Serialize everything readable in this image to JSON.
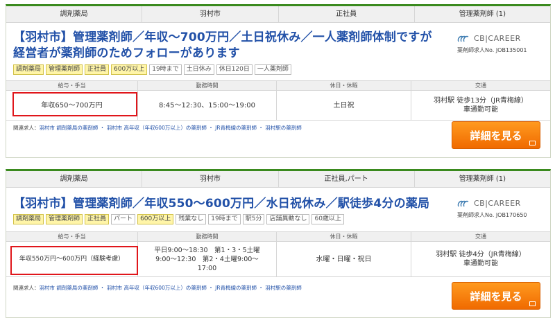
{
  "listings": [
    {
      "header": [
        "調剤薬局",
        "羽村市",
        "正社員",
        "管理薬剤師 (1)"
      ],
      "title": "【羽村市】管理薬剤師／年収～700万円／土日祝休み／一人薬剤師体制ですが経営者が薬剤師のためフォローがあります",
      "logo_text": "CB|CAREER",
      "job_no": "薬剤師求人No. JOB135001",
      "tags": [
        {
          "label": "調剤薬局",
          "hl": true
        },
        {
          "label": "管理薬剤師",
          "hl": true
        },
        {
          "label": "正社員",
          "hl": true
        },
        {
          "label": "600万以上",
          "hl": true
        },
        {
          "label": "19時まで",
          "hl": false
        },
        {
          "label": "土日休み",
          "hl": false
        },
        {
          "label": "休日120日",
          "hl": false
        },
        {
          "label": "一人薬剤師",
          "hl": false
        }
      ],
      "grid_headers": [
        "給与・手当",
        "勤務時間",
        "休日・休暇",
        "交通"
      ],
      "salary": "年収650～700万円",
      "hours": "8:45～12:30、15:00～19:00",
      "holidays": "土日祝",
      "access": "羽村駅 徒歩13分（JR青梅線）\n車通勤可能",
      "related_label": "関連求人：",
      "related": "羽村市 調剤薬局の薬剤師 ・ 羽村市 高年収（年収600万以上）の薬剤師 ・ JR青梅線の薬剤師 ・ 羽村駅の薬剤師",
      "button": "詳細を見る"
    },
    {
      "header": [
        "調剤薬局",
        "羽村市",
        "正社員,パート",
        "管理薬剤師 (1)"
      ],
      "title": "【羽村市】管理薬剤師／年収550～600万円／水日祝休み／駅徒歩4分の薬局",
      "logo_text": "CB|CAREER",
      "job_no": "薬剤師求人No. JOB170650",
      "tags": [
        {
          "label": "調剤薬局",
          "hl": true
        },
        {
          "label": "管理薬剤師",
          "hl": true
        },
        {
          "label": "正社員",
          "hl": true
        },
        {
          "label": "パート",
          "hl": false
        },
        {
          "label": "600万以上",
          "hl": true
        },
        {
          "label": "残業なし",
          "hl": false
        },
        {
          "label": "19時まで",
          "hl": false
        },
        {
          "label": "駅5分",
          "hl": false
        },
        {
          "label": "店舗異動なし",
          "hl": false
        },
        {
          "label": "60歳以上",
          "hl": false
        }
      ],
      "grid_headers": [
        "給与・手当",
        "勤務時間",
        "休日・休暇",
        "交通"
      ],
      "salary": "年収550万円～600万円（経験考慮）",
      "hours": "平日9:00～18:30　第1・3・5土曜\n9:00～12:30　第2・4土曜9:00～\n17:00",
      "holidays": "水曜・日曜・祝日",
      "access": "羽村駅 徒歩4分（JR青梅線）\n車通勤可能",
      "related_label": "関連求人：",
      "related": "羽村市 調剤薬局の薬剤師 ・ 羽村市 高年収（年収600万以上）の薬剤師 ・ JR青梅線の薬剤師 ・ 羽村駅の薬剤師",
      "button": "詳細を見る"
    }
  ],
  "colors": {
    "accent": "#3a8a1e",
    "title": "#2251a8",
    "button": "#f57c00",
    "highlight_box": "#e0161b"
  }
}
